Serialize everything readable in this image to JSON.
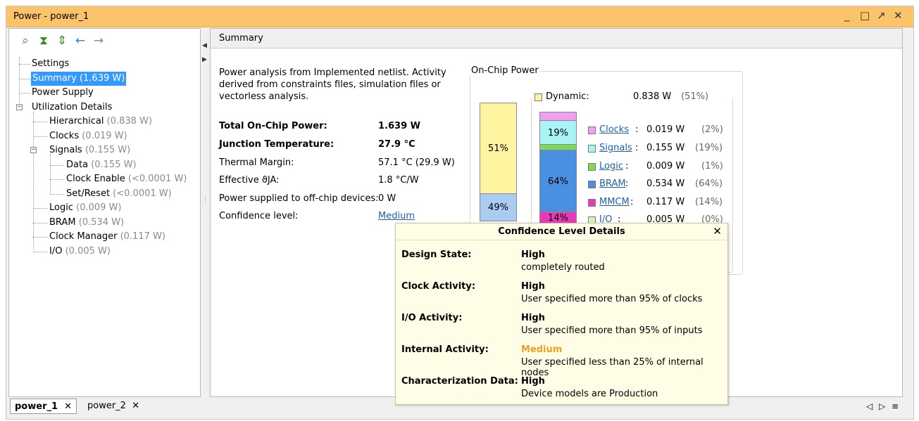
{
  "window": {
    "title": "Power - power_1",
    "minimize_icon": "minimize-icon",
    "maximize_icon": "maximize-icon",
    "restore_icon": "restore-icon",
    "close_icon": "close-icon"
  },
  "toolbar": {
    "icons": [
      "search-icon",
      "collapse-all-icon",
      "expand-all-icon",
      "back-arrow-icon",
      "forward-arrow-icon"
    ]
  },
  "tree": {
    "settings": "Settings",
    "summary": "Summary (1.639 W)",
    "power_supply": "Power Supply",
    "utilization": "Utilization Details",
    "hierarchical": {
      "label": "Hierarchical",
      "value": "(0.838 W)"
    },
    "clocks": {
      "label": "Clocks",
      "value": "(0.019 W)"
    },
    "signals": {
      "label": "Signals",
      "value": "(0.155 W)"
    },
    "data": {
      "label": "Data",
      "value": "(0.155 W)"
    },
    "clock_enable": {
      "label": "Clock Enable",
      "value": "(<0.0001 W)"
    },
    "set_reset": {
      "label": "Set/Reset",
      "value": "(<0.0001 W)"
    },
    "logic": {
      "label": "Logic",
      "value": "(0.009 W)"
    },
    "bram": {
      "label": "BRAM",
      "value": "(0.534 W)"
    },
    "clock_manager": {
      "label": "Clock Manager",
      "value": "(0.117 W)"
    },
    "io": {
      "label": "I/O",
      "value": "(0.005 W)"
    }
  },
  "summary": {
    "header": "Summary",
    "description": "Power analysis from Implemented netlist. Activity derived from constraints files, simulation files or vectorless analysis.",
    "rows": [
      {
        "label": "Total On-Chip Power:",
        "value": "1.639 W",
        "bold": true
      },
      {
        "label": "Junction Temperature:",
        "value": "27.9 °C",
        "bold": true
      },
      {
        "label": "Thermal Margin:",
        "value": "57.1 °C (29.9 W)",
        "bold": false
      },
      {
        "label": "Effective ϑJA:",
        "value": "1.8 °C/W",
        "bold": false
      },
      {
        "label": "Power supplied to off-chip devices:",
        "value": "0 W",
        "bold": false
      },
      {
        "label": "Confidence level:",
        "value": "Medium",
        "bold": false
      }
    ]
  },
  "onchip": {
    "title": "On-Chip Power",
    "total_bar": {
      "dynamic_pct": "51%",
      "static_pct": "49%"
    },
    "dynamic": {
      "label": "Dynamic:",
      "value": "0.838 W",
      "pct": "(51%)",
      "color": "#fff2a0"
    },
    "breakdown_bar": {
      "signals_pct": "19%",
      "bram_pct": "64%",
      "mmcm_pct": "14%"
    },
    "legend": [
      {
        "name": "Clocks",
        "value": "0.019 W",
        "pct": "(2%)",
        "color": "#f0a0f0"
      },
      {
        "name": "Signals",
        "value": "0.155 W",
        "pct": "(19%)",
        "color": "#a8f4f4"
      },
      {
        "name": "Logic",
        "value": "0.009 W",
        "pct": "(1%)",
        "color": "#7ed957"
      },
      {
        "name": "BRAM",
        "value": "0.534 W",
        "pct": "(64%)",
        "color": "#4a90e2"
      },
      {
        "name": "MMCM",
        "value": "0.117 W",
        "pct": "(14%)",
        "color": "#e839b8"
      },
      {
        "name": "I/O",
        "value": "0.005 W",
        "pct": "(0%)",
        "color": "#d7f3b5"
      }
    ]
  },
  "confidence_popup": {
    "title": "Confidence Level Details",
    "items": [
      {
        "label": "Design State:",
        "level": "High",
        "desc": "completely routed",
        "level_color": "#000000"
      },
      {
        "label": "Clock Activity:",
        "level": "High",
        "desc": "User specified more than 95% of clocks",
        "level_color": "#000000"
      },
      {
        "label": "I/O Activity:",
        "level": "High",
        "desc": "User specified more than 95% of inputs",
        "level_color": "#000000"
      },
      {
        "label": "Internal Activity:",
        "level": "Medium",
        "desc": "User specified less than 25% of internal nodes",
        "level_color": "#f0a020"
      },
      {
        "label": "Characterization Data:",
        "level": "High",
        "desc": "Device models are Production",
        "level_color": "#000000"
      }
    ]
  },
  "tabs": [
    {
      "label": "power_1",
      "active": true
    },
    {
      "label": "power_2",
      "active": false
    }
  ]
}
